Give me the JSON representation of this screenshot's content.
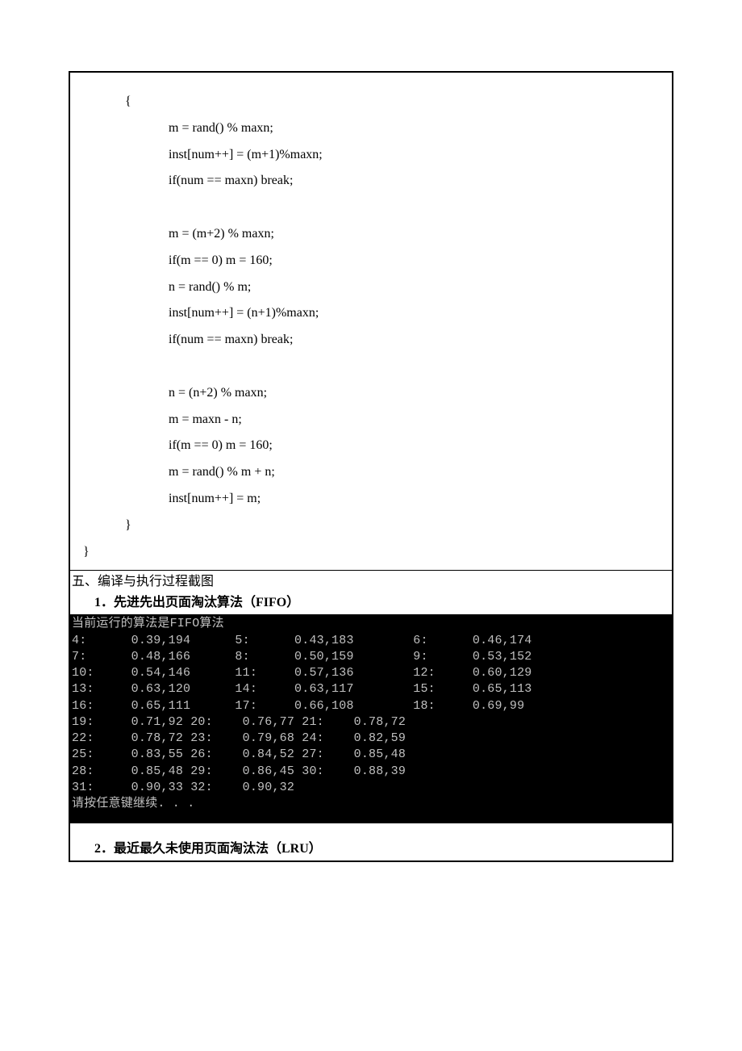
{
  "code": {
    "lines": [
      {
        "cls": "l1",
        "text": "{"
      },
      {
        "cls": "l2",
        "text": "m = rand() % maxn;"
      },
      {
        "cls": "l2",
        "text": "inst[num++] = (m+1)%maxn;"
      },
      {
        "cls": "l2",
        "text": "if(num == maxn) break;"
      },
      {
        "cls": "l2",
        "text": ""
      },
      {
        "cls": "l2",
        "text": "m = (m+2) % maxn;"
      },
      {
        "cls": "l2",
        "text": "if(m == 0) m = 160;"
      },
      {
        "cls": "l2",
        "text": "n = rand() % m;"
      },
      {
        "cls": "l2",
        "text": "inst[num++] = (n+1)%maxn;"
      },
      {
        "cls": "l2",
        "text": "if(num == maxn) break;"
      },
      {
        "cls": "l2",
        "text": ""
      },
      {
        "cls": "l2",
        "text": "n = (n+2) % maxn;"
      },
      {
        "cls": "l2",
        "text": "m = maxn - n;"
      },
      {
        "cls": "l2",
        "text": "if(m == 0) m = 160;"
      },
      {
        "cls": "l2",
        "text": "m = rand() % m + n;"
      },
      {
        "cls": "l2",
        "text": "inst[num++] = m;"
      },
      {
        "cls": "l1",
        "text": "}"
      },
      {
        "cls": "l0",
        "text": "}"
      }
    ]
  },
  "section5_heading": "五、编译与执行过程截图",
  "sub1_heading": "1．先进先出页面淘汰算法（FIFO）",
  "sub2_heading": "2．最近最久未使用页面淘汰法（LRU）",
  "terminal": {
    "title": "当前运行的算法是FIFO算法",
    "wide_rows": [
      [
        {
          "k": "4:",
          "v": "0.39,194"
        },
        {
          "k": "5:",
          "v": "0.43,183"
        },
        {
          "k": "6:",
          "v": "0.46,174"
        }
      ],
      [
        {
          "k": "7:",
          "v": "0.48,166"
        },
        {
          "k": "8:",
          "v": "0.50,159"
        },
        {
          "k": "9:",
          "v": "0.53,152"
        }
      ],
      [
        {
          "k": "10:",
          "v": "0.54,146"
        },
        {
          "k": "11:",
          "v": "0.57,136"
        },
        {
          "k": "12:",
          "v": "0.60,129"
        }
      ],
      [
        {
          "k": "13:",
          "v": "0.63,120"
        },
        {
          "k": "14:",
          "v": "0.63,117"
        },
        {
          "k": "15:",
          "v": "0.65,113"
        }
      ],
      [
        {
          "k": "16:",
          "v": "0.65,111"
        },
        {
          "k": "17:",
          "v": "0.66,108"
        },
        {
          "k": "18:",
          "v": "0.69,99"
        }
      ]
    ],
    "narrow_rows": [
      [
        {
          "k": "19:",
          "v": "0.71,92"
        },
        {
          "k": "20:",
          "v": "0.76,77"
        },
        {
          "k": "21:",
          "v": "0.78,72"
        }
      ],
      [
        {
          "k": "22:",
          "v": "0.78,72"
        },
        {
          "k": "23:",
          "v": "0.79,68"
        },
        {
          "k": "24:",
          "v": "0.82,59"
        }
      ],
      [
        {
          "k": "25:",
          "v": "0.83,55"
        },
        {
          "k": "26:",
          "v": "0.84,52"
        },
        {
          "k": "27:",
          "v": "0.85,48"
        }
      ],
      [
        {
          "k": "28:",
          "v": "0.85,48"
        },
        {
          "k": "29:",
          "v": "0.86,45"
        },
        {
          "k": "30:",
          "v": "0.88,39"
        }
      ],
      [
        {
          "k": "31:",
          "v": "0.90,33"
        },
        {
          "k": "32:",
          "v": "0.90,32"
        }
      ]
    ],
    "footer": "请按任意键继续. . ."
  }
}
